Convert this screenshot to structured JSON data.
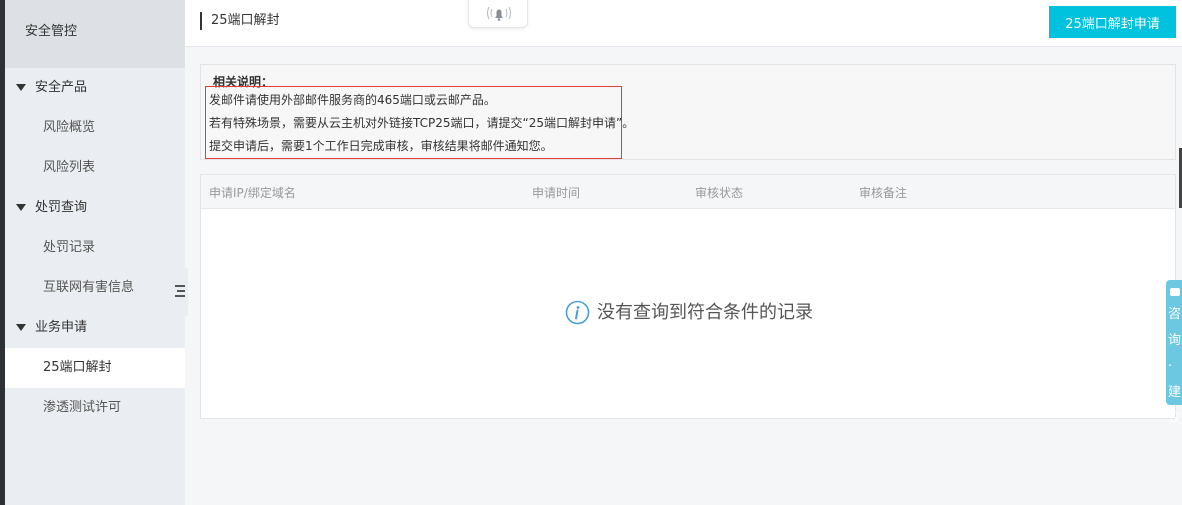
{
  "sidebar": {
    "title": "安全管控",
    "groups": [
      {
        "label": "安全产品",
        "items": [
          "风险概览",
          "风险列表"
        ]
      },
      {
        "label": "处罚查询",
        "items": [
          "处罚记录",
          "互联网有害信息"
        ]
      },
      {
        "label": "业务申请",
        "items": [
          "25端口解封",
          "渗透测试许可"
        ]
      }
    ],
    "active_item": "25端口解封"
  },
  "header": {
    "title": "25端口解封",
    "apply_button": "25端口解封申请"
  },
  "notice": {
    "title": "相关说明：",
    "lines": [
      "发邮件请使用外部邮件服务商的465端口或云邮产品。",
      "若有特殊场景，需要从云主机对外链接TCP25端口，请提交“25端口解封申请”。",
      "提交申请后，需要1个工作日完成审核，审核结果将邮件通知您。"
    ]
  },
  "table": {
    "columns": [
      "申请IP/绑定域名",
      "申请时间",
      "审核状态",
      "审核备注"
    ],
    "rows": [],
    "empty_text": "没有查询到符合条件的记录"
  },
  "float_tab": {
    "label": "咨询·建议"
  },
  "colors": {
    "accent": "#00c1de",
    "highlight_border": "#e03c3c",
    "float_tab": "#6cc7e0"
  },
  "icons": [
    "bell-icon",
    "info-icon",
    "collapse-menu-icon",
    "cup-icon"
  ]
}
